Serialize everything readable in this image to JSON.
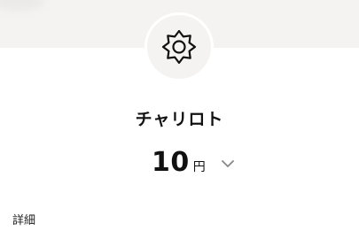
{
  "recipient": {
    "icon": "sun-icon",
    "name": "チャリロト"
  },
  "amount": {
    "value": "10",
    "unit": "円",
    "toggle_icon": "chevron-down-icon"
  },
  "details": {
    "label": "詳細"
  }
}
